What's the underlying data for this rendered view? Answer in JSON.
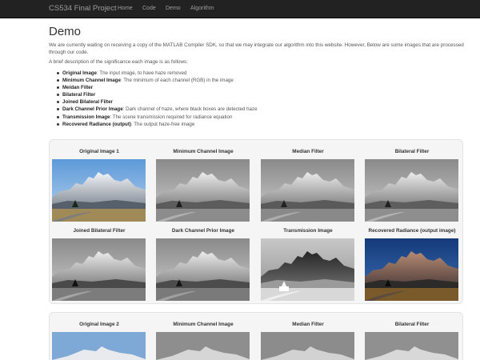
{
  "navbar": {
    "brand": "CS534 Final Project",
    "links": [
      "Home",
      "Code",
      "Demo",
      "Algorithm"
    ]
  },
  "page": {
    "title": "Demo",
    "intro": "We are currently waiting on receiving a copy of the MATLAB Compiler SDK, so that we may integrate our algorithm into this website. However, Below are some images that are processed through our code.",
    "brief": "A brief description of the significance each image is as follows:"
  },
  "descriptions": [
    {
      "term": "Original Image",
      "text": ": The input image, to have haze removed"
    },
    {
      "term": "Minimum Channel Image",
      "text": ": The minimum of each channel (RGB) in the image"
    },
    {
      "term": "Meidan Filter",
      "text": ""
    },
    {
      "term": "Bilateral Filter",
      "text": ""
    },
    {
      "term": "Joined Bilateral Filter",
      "text": ""
    },
    {
      "term": "Dark Channel Prior Image",
      "text": ": Dark channel of haze, where black boxes are detected haze"
    },
    {
      "term": "Transmission Image",
      "text": ": The scene transmission required for radiance equation"
    },
    {
      "term": "Recovered Radiance (output)",
      "text": ": The output haze-free image"
    }
  ],
  "gallery1": {
    "captions": [
      "Original Image 1",
      "Minimum Channel Image",
      "Median Filter",
      "Bilateral Filter",
      "Joined Bilateral Filter",
      "Dark Channel Prior Image",
      "Transmission Image",
      "Recovered Radiance (output image)"
    ]
  },
  "gallery2": {
    "captions": [
      "Original Image 2",
      "Minimum Channel Image",
      "Median Filter",
      "Bilateral Filter"
    ]
  },
  "colors": {
    "navbar_bg": "#222222",
    "nav_text": "#9d9d9d",
    "panel_bg": "#f5f5f5",
    "panel_border": "#e3e3e3"
  }
}
